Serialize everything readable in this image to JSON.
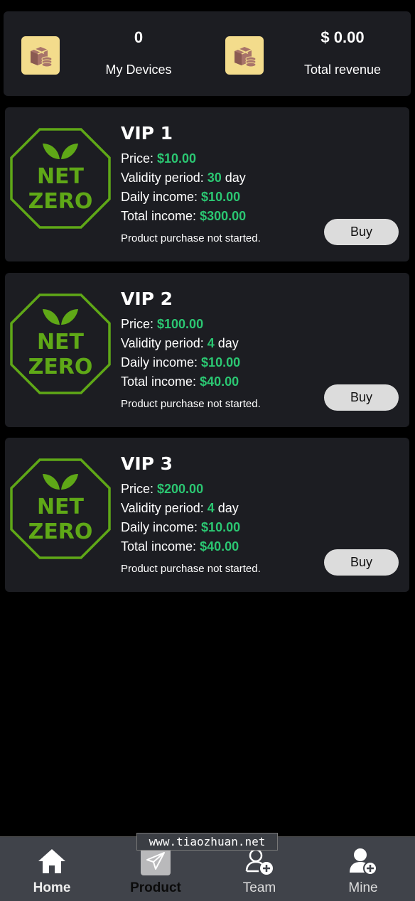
{
  "stats": {
    "devices_value": "0",
    "devices_label": "My Devices",
    "revenue_value": "$ 0.00",
    "revenue_label": "Total revenue"
  },
  "logo": {
    "line1": "NET",
    "line2": "ZERO"
  },
  "products": [
    {
      "title": "VIP 1",
      "price_label": "Price: ",
      "price": "$10.00",
      "validity_label": "Validity period: ",
      "validity": "30",
      "validity_unit": " day",
      "daily_label": "Daily income: ",
      "daily": "$10.00",
      "total_label": "Total income: ",
      "total": "$300.00",
      "status": "Product purchase not started.",
      "buy_label": "Buy"
    },
    {
      "title": "VIP 2",
      "price_label": "Price: ",
      "price": "$100.00",
      "validity_label": "Validity period: ",
      "validity": "4",
      "validity_unit": " day",
      "daily_label": "Daily income: ",
      "daily": "$10.00",
      "total_label": "Total income: ",
      "total": "$40.00",
      "status": "Product purchase not started.",
      "buy_label": "Buy"
    },
    {
      "title": "VIP 3",
      "price_label": "Price: ",
      "price": "$200.00",
      "validity_label": "Validity period: ",
      "validity": "4",
      "validity_unit": " day",
      "daily_label": "Daily income: ",
      "daily": "$10.00",
      "total_label": "Total income: ",
      "total": "$40.00",
      "status": "Product purchase not started.",
      "buy_label": "Buy"
    }
  ],
  "tabs": [
    {
      "label": "Home",
      "icon": "home-icon"
    },
    {
      "label": "Product",
      "icon": "paper-plane-icon"
    },
    {
      "label": "Team",
      "icon": "team-add-icon"
    },
    {
      "label": "Mine",
      "icon": "user-add-icon"
    }
  ],
  "watermark": "www.tiaozhuan.net",
  "colors": {
    "accent_green": "#2bc772",
    "logo_green": "#5fa817",
    "icon_bg": "#f3dc8c"
  }
}
